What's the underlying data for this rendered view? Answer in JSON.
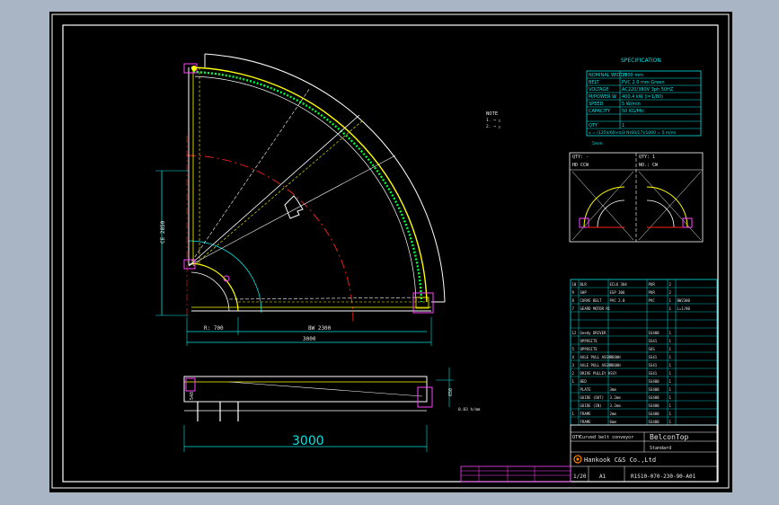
{
  "app": {
    "title": "Curved belt conveyor drawing"
  },
  "note": {
    "title": "NOTE",
    "lines": [
      "1. → △",
      "2. → △"
    ]
  },
  "spec": {
    "title": "SPECIFICATION",
    "rows": [
      {
        "k": "NOMINAL WIDTH",
        "v": "2300 mm"
      },
      {
        "k": "BELT",
        "v": "PVC 2.0 mm Green"
      },
      {
        "k": "VOLTAGE",
        "v": "AC220/380V 3ph 50HZ"
      },
      {
        "k": "M/POWER W",
        "v": "400.4 kW (i=1/80)"
      },
      {
        "k": "SPEED",
        "v": "5 W/min"
      },
      {
        "k": "CAPACITY",
        "v": "50 KG/Mtr."
      },
      {
        "k": "QTY",
        "v": "1"
      }
    ],
    "formula": "v = (125π/60×π)3 N(60/17)/1000 = 5 m/mi",
    "foot": "5mm"
  },
  "layout_box": {
    "left_head": "QTY: -",
    "left_sub": "HD   CCW",
    "right_head": "QTY: 1",
    "right_sub": "NO.: CW"
  },
  "dims": {
    "r700": "R: 700",
    "bw": "BW 2300",
    "total_width": "3000",
    "height_label": "CE 2850",
    "bottom_total": "3000",
    "dim_548": "548",
    "dim_650": "650",
    "dim_height": "0.83 h/mm"
  },
  "bom": {
    "rows": [
      [
        "10",
        "BLR",
        "ECL6 304",
        "PUR",
        "2",
        ""
      ],
      [
        "9",
        "SHP",
        "ESP 306",
        "PUR",
        "2",
        ""
      ],
      [
        "8",
        "CURVE BELT",
        "PVC 2.0",
        "PVC",
        "1",
        "BW2300"
      ],
      [
        "7",
        "GEARD MOTOR RC",
        "",
        "",
        "1",
        "i=1/80"
      ],
      [
        "",
        "",
        "",
        "",
        "",
        ""
      ],
      [
        "",
        "",
        "",
        "",
        "",
        ""
      ],
      [
        "12",
        "Geedy DRIVER",
        "",
        "SS400",
        "1",
        ""
      ],
      [
        "",
        "OPPOSITE",
        "",
        "SS41",
        "1",
        ""
      ],
      [
        "5",
        "OPPOSITE",
        "",
        "SUS",
        "1",
        ""
      ],
      [
        "4",
        "AXLE PULL ASSY",
        "Ø600H",
        "SS41",
        "1",
        ""
      ],
      [
        "3",
        "AXLE PULL ASSY",
        "Ø600H",
        "SS41",
        "1",
        ""
      ],
      [
        "2",
        "DRIVE PULLEY ASSY",
        "",
        "SS41",
        "1",
        ""
      ],
      [
        "1",
        "BED",
        "",
        "SS400",
        "1",
        ""
      ],
      [
        "",
        "PLATE",
        "3mm",
        "SS400",
        "1",
        ""
      ],
      [
        "",
        "GUIDE (OUT)",
        "3.2mm",
        "SS400",
        "1",
        ""
      ],
      [
        "",
        "GUIDE (IN)",
        "3.2mm",
        "SS400",
        "1",
        ""
      ],
      [
        "1",
        "FRAME",
        "2mm",
        "SS400",
        "1",
        ""
      ],
      [
        "",
        "FRAME",
        "6mm",
        "SS400",
        "1",
        ""
      ]
    ]
  },
  "title_block": {
    "desc": "Curved belt conveyor",
    "project": "BelconTop",
    "standard": "Standard",
    "company": "Hankook C&S Co.,Ltd",
    "scale": "1/20",
    "size": "A1",
    "drawing_no": "R1510-070-230-90-A01",
    "qty_label": "QTY"
  },
  "colors": {
    "background": "#000000",
    "frame": "#ffffff",
    "dimension": "#00e5e5",
    "centerline": "#ff2020",
    "belt_edge": "#ffff00",
    "guide": "#00ff40",
    "table": "#00e5e5"
  }
}
